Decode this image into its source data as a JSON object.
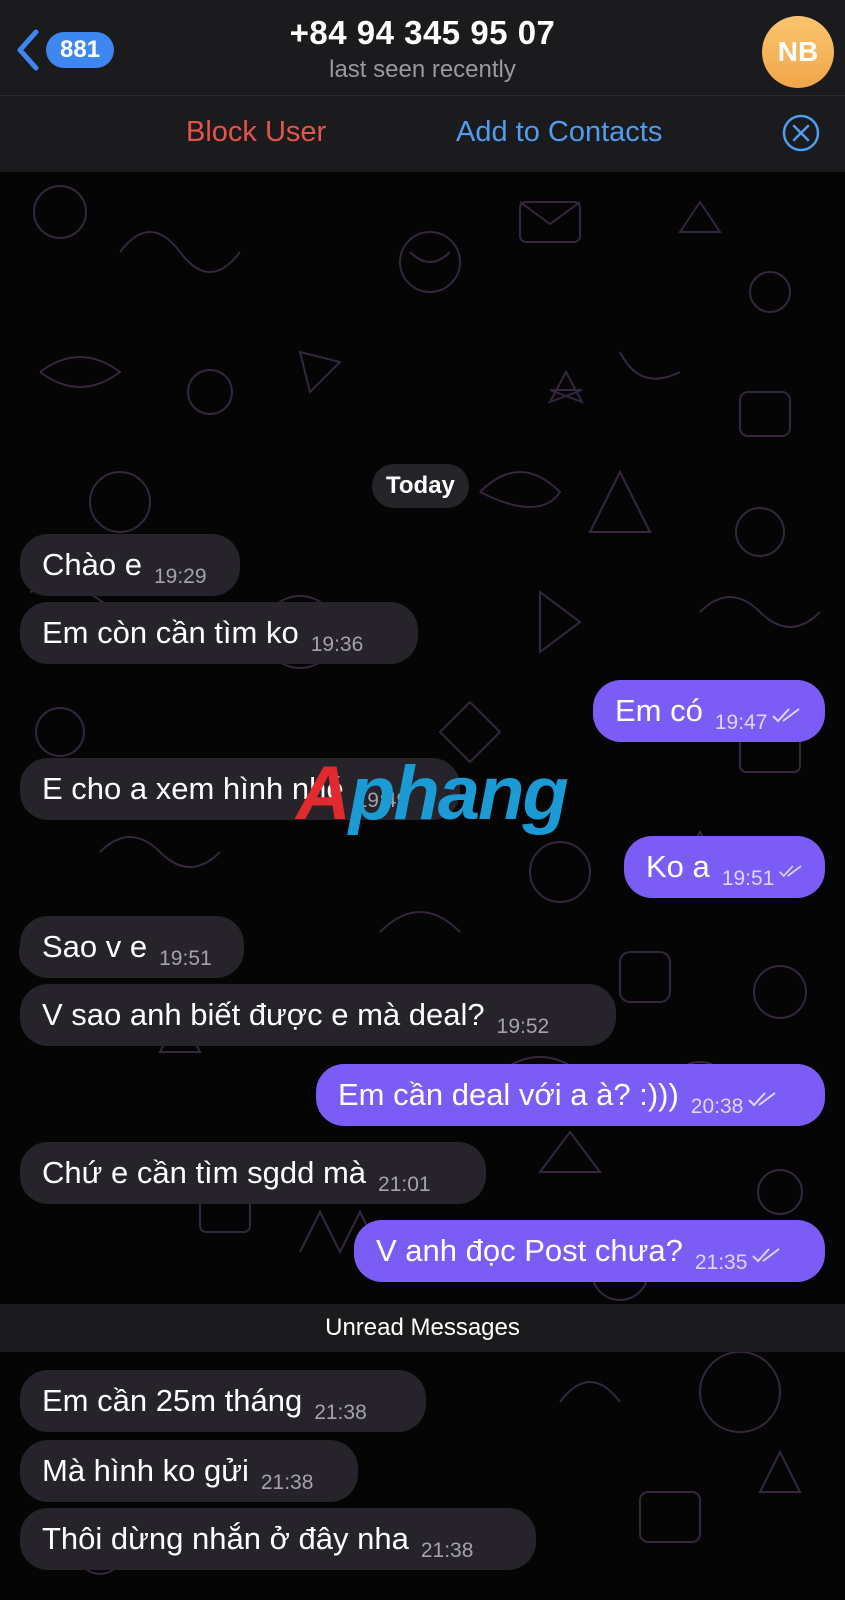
{
  "header": {
    "back_count": "881",
    "title": "+84 94 345 95 07",
    "subtitle": "last seen recently",
    "avatar_initials": "NB"
  },
  "actions": {
    "block_label": "Block User",
    "add_label": "Add to Contacts"
  },
  "chat": {
    "date_label": "Today",
    "unread_label": "Unread Messages",
    "messages": [
      {
        "dir": "in",
        "text": "Chào e",
        "time": "19:29"
      },
      {
        "dir": "in",
        "text": "Em còn cần tìm ko",
        "time": "19:36"
      },
      {
        "dir": "out",
        "text": "Em có",
        "time": "19:47",
        "read": true
      },
      {
        "dir": "in",
        "text": "E cho a xem hình nhé",
        "time": "19:49"
      },
      {
        "dir": "out",
        "text": "Ko a",
        "time": "19:51",
        "read": true
      },
      {
        "dir": "in",
        "text": "Sao v e",
        "time": "19:51"
      },
      {
        "dir": "in",
        "text": "V sao anh biết được e mà deal?",
        "time": "19:52"
      },
      {
        "dir": "out",
        "text": "Em cần deal với a à? :)))",
        "time": "20:38",
        "read": true
      },
      {
        "dir": "in",
        "text": "Chứ e cần tìm sgdd mà",
        "time": "21:01"
      },
      {
        "dir": "out",
        "text": "V anh đọc Post chưa?",
        "time": "21:35",
        "read": true
      },
      {
        "dir": "in",
        "text": "Em cần 25m tháng",
        "time": "21:38"
      },
      {
        "dir": "in",
        "text": "Mà hình ko gửi",
        "time": "21:38"
      },
      {
        "dir": "in",
        "text": "Thôi dừng nhắn ở đây nha",
        "time": "21:38"
      }
    ]
  },
  "watermark": {
    "part1": "A",
    "part2": "phang"
  },
  "colors": {
    "incoming_bubble": "#26232b",
    "outgoing_bubble": "#7b5cf5",
    "accent_blue": "#4f9cf0",
    "danger_red": "#e5534b",
    "avatar": "#f2a64a"
  },
  "icons": {
    "back": "chevron-left-icon",
    "close": "close-circle-icon",
    "read": "double-check-icon"
  }
}
